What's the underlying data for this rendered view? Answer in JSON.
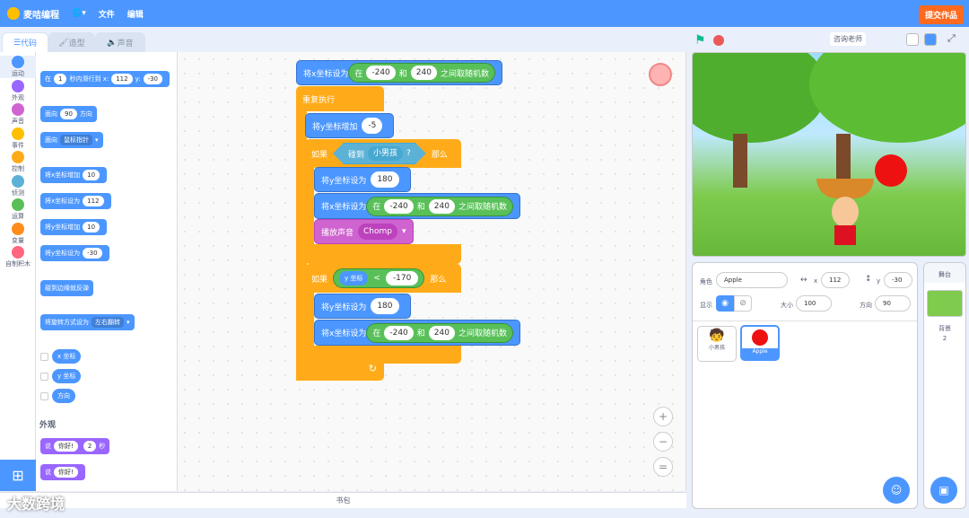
{
  "menubar": {
    "brand": "麦咭编程",
    "globe": "🌐",
    "file": "文件",
    "edit": "编辑",
    "submit": "提交作品"
  },
  "tabs": [
    {
      "label": "代码"
    },
    {
      "label": "造型"
    },
    {
      "label": "声音"
    }
  ],
  "categories": [
    {
      "label": "运动",
      "color": "#4c97ff"
    },
    {
      "label": "外观",
      "color": "#9966ff"
    },
    {
      "label": "声音",
      "color": "#cf63cf"
    },
    {
      "label": "事件",
      "color": "#ffbf00"
    },
    {
      "label": "控制",
      "color": "#ffab19"
    },
    {
      "label": "侦测",
      "color": "#5cb1d6"
    },
    {
      "label": "运算",
      "color": "#59c059"
    },
    {
      "label": "变量",
      "color": "#ff8c1a"
    },
    {
      "label": "自制积木",
      "color": "#ff6680"
    }
  ],
  "palette": {
    "glide1": {
      "a": "在",
      "b": "1",
      "c": "秒内滑行到 x:",
      "d": "112",
      "e": "y:",
      "f": "-30"
    },
    "point": {
      "a": "面向",
      "b": "90",
      "c": "方向"
    },
    "pointto": {
      "a": "面向",
      "b": "鼠标指针"
    },
    "changex": {
      "a": "将x坐标增加",
      "b": "10"
    },
    "setx": {
      "a": "将x坐标设为",
      "b": "112"
    },
    "changey": {
      "a": "将y坐标增加",
      "b": "10"
    },
    "sety": {
      "a": "将y坐标设为",
      "b": "-30"
    },
    "bounce": "碰到边缘就反弹",
    "rotation": {
      "a": "将旋转方式设为",
      "b": "左右翻转"
    },
    "rep_x": "x 坐标",
    "rep_y": "y 坐标",
    "rep_dir": "方向",
    "looks_head": "外观",
    "say1": {
      "a": "说",
      "b": "你好!",
      "c": "2",
      "d": "秒"
    },
    "say2": {
      "a": "说",
      "b": "你好!"
    }
  },
  "code": {
    "set_x_top": {
      "label": "将x坐标设为",
      "op_in": "在",
      "a": "-240",
      "and": "和",
      "b": "240",
      "tail": "之间取随机数"
    },
    "forever": "重复执行",
    "change_y": {
      "label": "将y坐标增加",
      "v": "-5"
    },
    "if1": {
      "if": "如果",
      "touch": "碰到",
      "target": "小男孩",
      "q": "?",
      "then": "那么"
    },
    "if1_sety": {
      "label": "将y坐标设为",
      "v": "180"
    },
    "if1_setx": {
      "label": "将x坐标设为",
      "op_in": "在",
      "a": "-240",
      "and": "和",
      "b": "240",
      "tail": "之间取随机数"
    },
    "play": {
      "label": "播放声音",
      "v": "Chomp"
    },
    "if2": {
      "if": "如果",
      "rep": "y 坐标",
      "lt": "<",
      "v": "-170",
      "then": "那么"
    },
    "if2_sety": {
      "label": "将y坐标设为",
      "v": "180"
    },
    "if2_setx": {
      "label": "将x坐标设为",
      "op_in": "在",
      "a": "-240",
      "and": "和",
      "b": "240",
      "tail": "之间取随机数"
    }
  },
  "backpack": "书包",
  "stage": {
    "watermark": "咨询老师"
  },
  "sprite_info": {
    "sprite_label": "角色",
    "sprite_name": "Apple",
    "x_label": "x",
    "x": "112",
    "y_label": "y",
    "y": "-30",
    "show_label": "显示",
    "size_label": "大小",
    "size": "100",
    "dir_label": "方向",
    "dir": "90"
  },
  "sprites": [
    {
      "name": "小男孩"
    },
    {
      "name": "Apple"
    }
  ],
  "backdrop": {
    "title": "舞台",
    "label": "背景",
    "count": "2"
  },
  "watermark": "大数跨境"
}
